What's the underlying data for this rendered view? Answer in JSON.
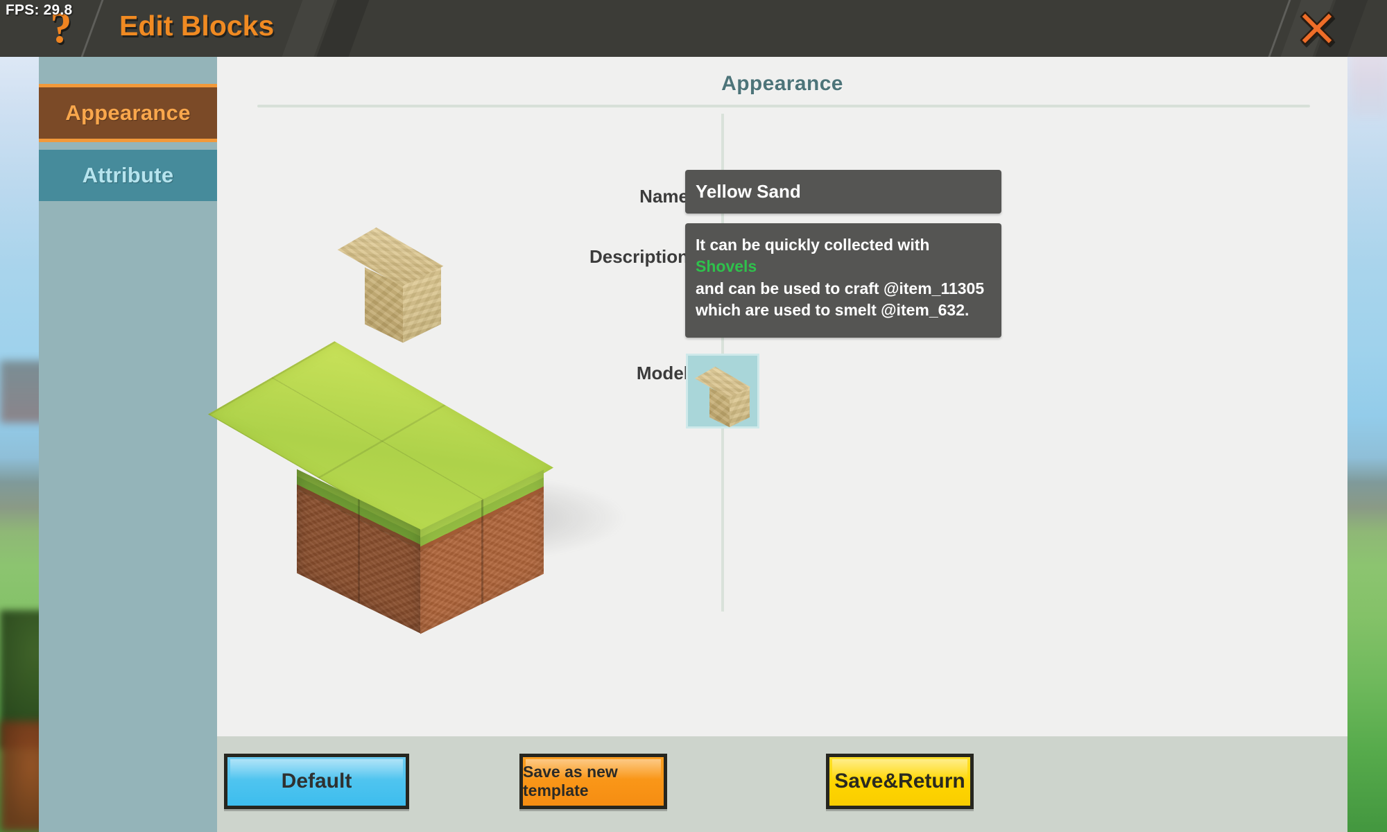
{
  "hud": {
    "fps": "FPS: 29.8",
    "help_icon": "?"
  },
  "header": {
    "title": "Edit Blocks",
    "close_icon": "close-icon",
    "accent_color": "#f08a22",
    "background_color": "#3c3c37"
  },
  "sidebar": {
    "items": [
      {
        "label": "Appearance",
        "active": true
      },
      {
        "label": "Attribute",
        "active": false
      }
    ],
    "active_bg": "#7b4a27",
    "active_border": "#f2993a",
    "active_text": "#f9a74c",
    "inactive_bg": "#468b9b",
    "inactive_text": "#b6e4ee",
    "background_color": "#94b4b9"
  },
  "panel": {
    "title": "Appearance",
    "title_color": "#4d7479",
    "background_color": "#f0f0ef"
  },
  "preview": {
    "block_label": "sand-block",
    "platform_label": "grass-dirt-platform"
  },
  "form": {
    "name": {
      "label": "Name",
      "value": "Yellow Sand",
      "placeholder": "Name"
    },
    "description": {
      "label": "Description",
      "line1_before": "It can be quickly collected with ",
      "line1_highlight": "Shovels",
      "line2": "and can be used to craft @item_11305",
      "line3": "which are used to smelt @item_632.",
      "highlight_color": "#2fc14c",
      "placeholder": "Description"
    },
    "model": {
      "label": "Model",
      "slot_icon": "sand-cube-icon",
      "slot_background": "#a9d6d9"
    },
    "field_background": "#555553"
  },
  "footer": {
    "buttons": [
      {
        "label": "Default",
        "color": "#4ec4ef"
      },
      {
        "label": "Save as new template",
        "color": "#f99517"
      },
      {
        "label": "Save&Return",
        "color": "#ffd500"
      }
    ],
    "background_color": "#cdd4cc"
  }
}
